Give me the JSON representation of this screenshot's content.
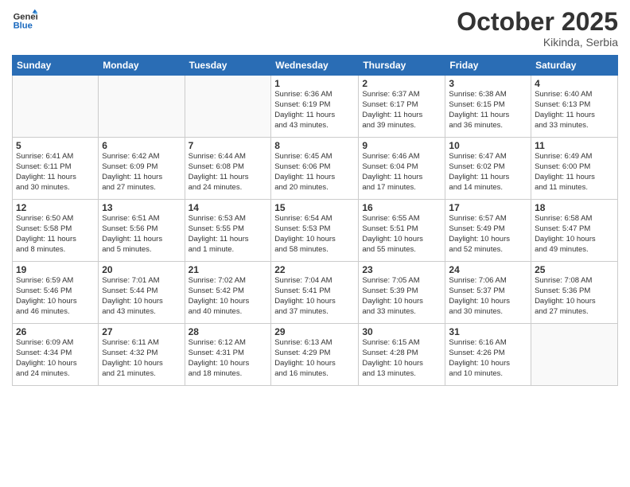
{
  "header": {
    "logo_line1": "General",
    "logo_line2": "Blue",
    "month_title": "October 2025",
    "location": "Kikinda, Serbia"
  },
  "weekdays": [
    "Sunday",
    "Monday",
    "Tuesday",
    "Wednesday",
    "Thursday",
    "Friday",
    "Saturday"
  ],
  "weeks": [
    [
      {
        "day": "",
        "info": ""
      },
      {
        "day": "",
        "info": ""
      },
      {
        "day": "",
        "info": ""
      },
      {
        "day": "1",
        "info": "Sunrise: 6:36 AM\nSunset: 6:19 PM\nDaylight: 11 hours\nand 43 minutes."
      },
      {
        "day": "2",
        "info": "Sunrise: 6:37 AM\nSunset: 6:17 PM\nDaylight: 11 hours\nand 39 minutes."
      },
      {
        "day": "3",
        "info": "Sunrise: 6:38 AM\nSunset: 6:15 PM\nDaylight: 11 hours\nand 36 minutes."
      },
      {
        "day": "4",
        "info": "Sunrise: 6:40 AM\nSunset: 6:13 PM\nDaylight: 11 hours\nand 33 minutes."
      }
    ],
    [
      {
        "day": "5",
        "info": "Sunrise: 6:41 AM\nSunset: 6:11 PM\nDaylight: 11 hours\nand 30 minutes."
      },
      {
        "day": "6",
        "info": "Sunrise: 6:42 AM\nSunset: 6:09 PM\nDaylight: 11 hours\nand 27 minutes."
      },
      {
        "day": "7",
        "info": "Sunrise: 6:44 AM\nSunset: 6:08 PM\nDaylight: 11 hours\nand 24 minutes."
      },
      {
        "day": "8",
        "info": "Sunrise: 6:45 AM\nSunset: 6:06 PM\nDaylight: 11 hours\nand 20 minutes."
      },
      {
        "day": "9",
        "info": "Sunrise: 6:46 AM\nSunset: 6:04 PM\nDaylight: 11 hours\nand 17 minutes."
      },
      {
        "day": "10",
        "info": "Sunrise: 6:47 AM\nSunset: 6:02 PM\nDaylight: 11 hours\nand 14 minutes."
      },
      {
        "day": "11",
        "info": "Sunrise: 6:49 AM\nSunset: 6:00 PM\nDaylight: 11 hours\nand 11 minutes."
      }
    ],
    [
      {
        "day": "12",
        "info": "Sunrise: 6:50 AM\nSunset: 5:58 PM\nDaylight: 11 hours\nand 8 minutes."
      },
      {
        "day": "13",
        "info": "Sunrise: 6:51 AM\nSunset: 5:56 PM\nDaylight: 11 hours\nand 5 minutes."
      },
      {
        "day": "14",
        "info": "Sunrise: 6:53 AM\nSunset: 5:55 PM\nDaylight: 11 hours\nand 1 minute."
      },
      {
        "day": "15",
        "info": "Sunrise: 6:54 AM\nSunset: 5:53 PM\nDaylight: 10 hours\nand 58 minutes."
      },
      {
        "day": "16",
        "info": "Sunrise: 6:55 AM\nSunset: 5:51 PM\nDaylight: 10 hours\nand 55 minutes."
      },
      {
        "day": "17",
        "info": "Sunrise: 6:57 AM\nSunset: 5:49 PM\nDaylight: 10 hours\nand 52 minutes."
      },
      {
        "day": "18",
        "info": "Sunrise: 6:58 AM\nSunset: 5:47 PM\nDaylight: 10 hours\nand 49 minutes."
      }
    ],
    [
      {
        "day": "19",
        "info": "Sunrise: 6:59 AM\nSunset: 5:46 PM\nDaylight: 10 hours\nand 46 minutes."
      },
      {
        "day": "20",
        "info": "Sunrise: 7:01 AM\nSunset: 5:44 PM\nDaylight: 10 hours\nand 43 minutes."
      },
      {
        "day": "21",
        "info": "Sunrise: 7:02 AM\nSunset: 5:42 PM\nDaylight: 10 hours\nand 40 minutes."
      },
      {
        "day": "22",
        "info": "Sunrise: 7:04 AM\nSunset: 5:41 PM\nDaylight: 10 hours\nand 37 minutes."
      },
      {
        "day": "23",
        "info": "Sunrise: 7:05 AM\nSunset: 5:39 PM\nDaylight: 10 hours\nand 33 minutes."
      },
      {
        "day": "24",
        "info": "Sunrise: 7:06 AM\nSunset: 5:37 PM\nDaylight: 10 hours\nand 30 minutes."
      },
      {
        "day": "25",
        "info": "Sunrise: 7:08 AM\nSunset: 5:36 PM\nDaylight: 10 hours\nand 27 minutes."
      }
    ],
    [
      {
        "day": "26",
        "info": "Sunrise: 6:09 AM\nSunset: 4:34 PM\nDaylight: 10 hours\nand 24 minutes."
      },
      {
        "day": "27",
        "info": "Sunrise: 6:11 AM\nSunset: 4:32 PM\nDaylight: 10 hours\nand 21 minutes."
      },
      {
        "day": "28",
        "info": "Sunrise: 6:12 AM\nSunset: 4:31 PM\nDaylight: 10 hours\nand 18 minutes."
      },
      {
        "day": "29",
        "info": "Sunrise: 6:13 AM\nSunset: 4:29 PM\nDaylight: 10 hours\nand 16 minutes."
      },
      {
        "day": "30",
        "info": "Sunrise: 6:15 AM\nSunset: 4:28 PM\nDaylight: 10 hours\nand 13 minutes."
      },
      {
        "day": "31",
        "info": "Sunrise: 6:16 AM\nSunset: 4:26 PM\nDaylight: 10 hours\nand 10 minutes."
      },
      {
        "day": "",
        "info": ""
      }
    ]
  ]
}
